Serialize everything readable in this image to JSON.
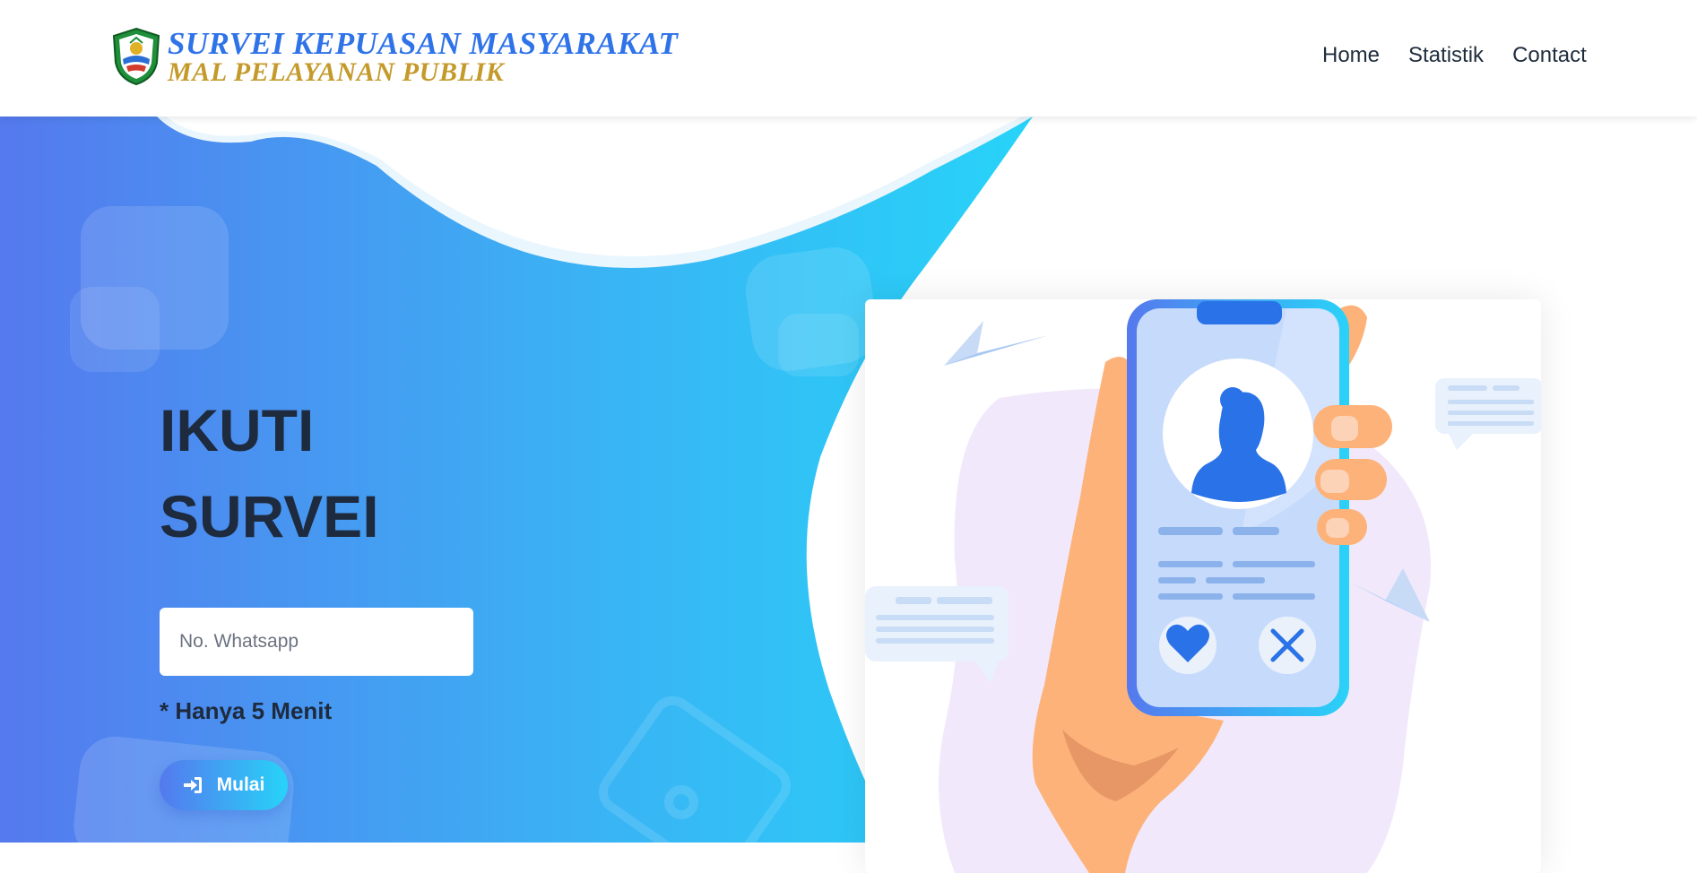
{
  "header": {
    "brand_line1": "SURVEI KEPUASAN MASYARAKAT",
    "brand_line2": "MAL PELAYANAN PUBLIK",
    "logo_icon": "regional-emblem-logo",
    "nav": [
      {
        "label": "Home"
      },
      {
        "label": "Statistik"
      },
      {
        "label": "Contact"
      }
    ]
  },
  "hero": {
    "title_line1": "IKUTI",
    "title_line2": "SURVEI",
    "input_placeholder": "No. Whatsapp",
    "note": "* Hanya 5 Menit",
    "button_label": "Mulai",
    "button_icon": "sign-in-icon",
    "illustration": "hand-holding-phone-profile-illustration"
  },
  "colors": {
    "gradient_start": "#5579ee",
    "gradient_end": "#27d3f8",
    "brand_blue": "#2f73e8",
    "brand_gold": "#c49a2a",
    "title_text": "#1e2a3d"
  }
}
